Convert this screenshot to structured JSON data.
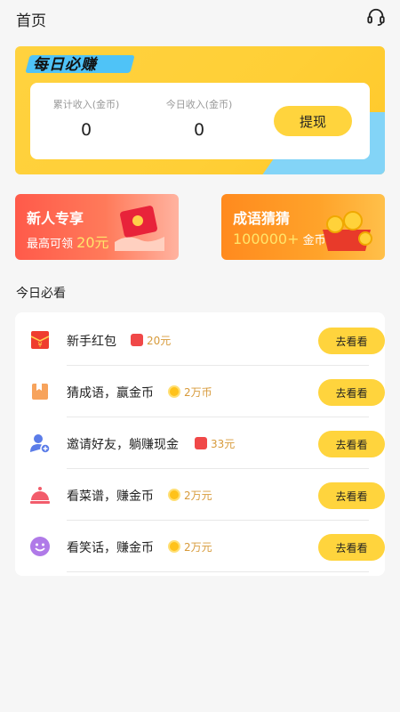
{
  "header": {
    "title": "首页",
    "support_icon": "headset-icon"
  },
  "banner": {
    "logo_text": "每日必赚",
    "stats": [
      {
        "label": "累计收入(金币)",
        "value": "0"
      },
      {
        "label": "今日收入(金币)",
        "value": "0"
      }
    ],
    "withdraw_label": "提现"
  },
  "promos": [
    {
      "title": "新人专享",
      "subtitle_prefix": "最高可领 ",
      "subtitle_highlight": "20元",
      "subtitle_suffix": ""
    },
    {
      "title": "成语猜猜",
      "subtitle_prefix": "",
      "subtitle_highlight": "100000+",
      "subtitle_suffix": " 金币"
    }
  ],
  "section_title": "今日必看",
  "tasks": [
    {
      "name": "新手红包",
      "icon": "red-envelope-icon",
      "reward_icon": "red-packet-icon",
      "reward": "20元",
      "button": "去看看"
    },
    {
      "name": "猜成语，赢金币",
      "icon": "book-icon",
      "reward_icon": "coin-icon",
      "reward": "2万币",
      "button": "去看看"
    },
    {
      "name": "邀请好友，躺赚现金",
      "icon": "add-user-icon",
      "reward_icon": "red-packet-icon",
      "reward": "33元",
      "button": "去看看"
    },
    {
      "name": "看菜谱，赚金币",
      "icon": "food-cloche-icon",
      "reward_icon": "coin-icon",
      "reward": "2万元",
      "button": "去看看"
    },
    {
      "name": "看笑话，赚金币",
      "icon": "smile-icon",
      "reward_icon": "coin-icon",
      "reward": "2万元",
      "button": "去看看"
    }
  ],
  "colors": {
    "accent": "#ffd43d",
    "banner": "#ffd23f",
    "reward_text": "#d79a3a"
  }
}
